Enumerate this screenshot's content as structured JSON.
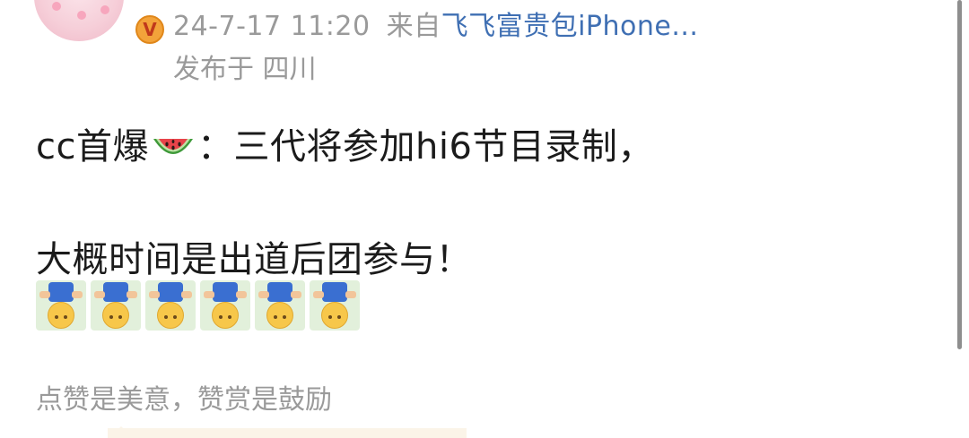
{
  "post": {
    "time": "24-7-17 11:20",
    "from_label": "来自",
    "source": "飞飞富贵包iPhone...",
    "location": "发布于 四川",
    "line1_prefix": "cc首爆",
    "line1_suffix": "：三代将参加hi6节目录制，",
    "line2": "大概时间是出道后团参与！",
    "emoji_icons": [
      "upside-down-face-emoji",
      "upside-down-face-emoji",
      "upside-down-face-emoji",
      "upside-down-face-emoji",
      "upside-down-face-emoji",
      "upside-down-face-emoji"
    ]
  },
  "footer": {
    "reward_text": "点赞是美意，赞赏是鼓励"
  },
  "colors": {
    "meta_gray": "#9a9a9a",
    "link_blue": "#3f6fb3",
    "text_dark": "#1b1b1b",
    "badge_orange": "#f3a33a"
  }
}
